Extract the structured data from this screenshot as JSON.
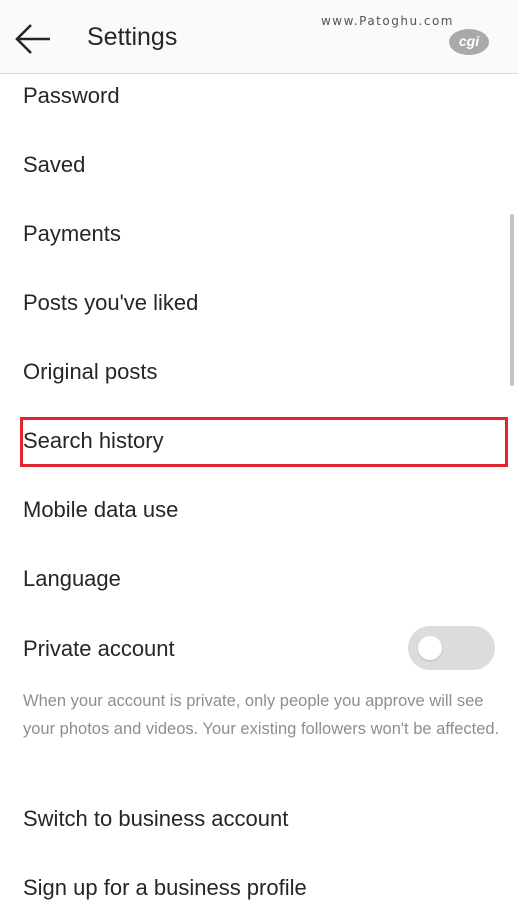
{
  "header": {
    "back_icon": "arrow-left-icon",
    "title": "Settings",
    "watermark_text": "www.Patoghu.com",
    "watermark_logo_text": "cgi"
  },
  "menu": {
    "password": "Password",
    "saved": "Saved",
    "payments": "Payments",
    "posts_liked": "Posts you've liked",
    "original_posts": "Original posts",
    "search_history": "Search history",
    "mobile_data_use": "Mobile data use",
    "language": "Language",
    "private_account": "Private account",
    "private_account_description": "When your account is private, only people you approve will see your photos and videos. Your existing followers won't be affected.",
    "switch_business": "Switch to business account",
    "business_profile": "Sign up for a business profile"
  },
  "private_account_toggle": {
    "state": "off"
  },
  "colors": {
    "highlight_border": "#e0232e",
    "text": "#262626",
    "secondary_text": "#8e8e8e",
    "toggle_track": "#dcdcdc"
  }
}
